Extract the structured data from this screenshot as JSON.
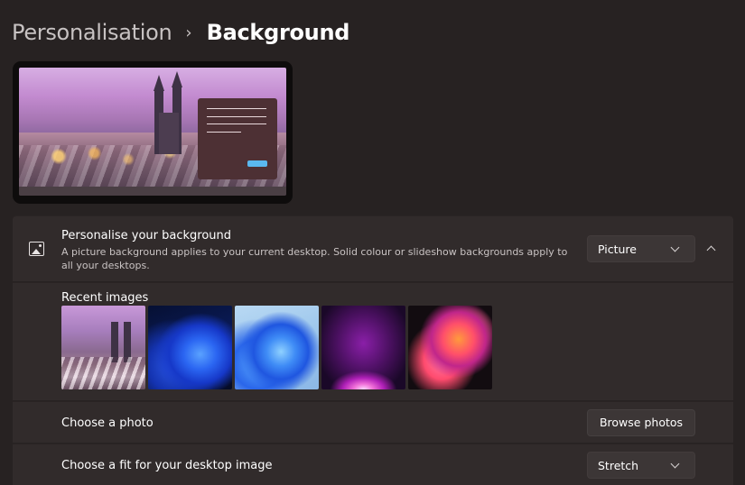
{
  "breadcrumb": {
    "parent": "Personalisation",
    "separator": "›",
    "current": "Background"
  },
  "colors": {
    "page_bg": "#272222",
    "card_bg": "#312b2b",
    "control_bg": "#3c3636",
    "accent": "#5ab8ef"
  },
  "personalise": {
    "icon": "image-icon",
    "title": "Personalise your background",
    "description": "A picture background applies to your current desktop. Solid colour or slideshow backgrounds apply to all your desktops.",
    "selected_type": "Picture"
  },
  "recent": {
    "label": "Recent images",
    "images": [
      "prague-winter-thumbnail",
      "windows-bloom-dark-thumbnail",
      "windows-bloom-light-thumbnail",
      "purple-glow-thumbnail",
      "colorful-ribbon-thumbnail"
    ]
  },
  "photo": {
    "label": "Choose a photo",
    "button": "Browse photos"
  },
  "fit": {
    "label": "Choose a fit for your desktop image",
    "selected": "Stretch"
  }
}
